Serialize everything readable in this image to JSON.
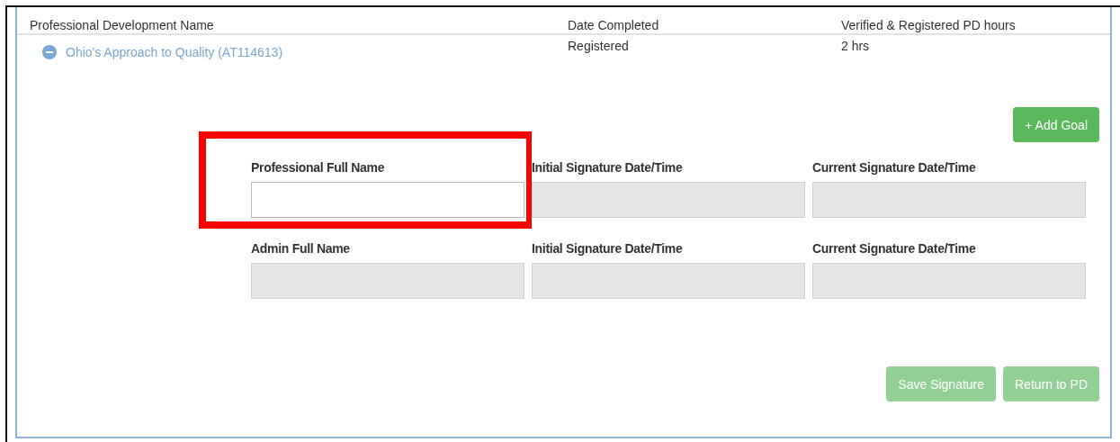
{
  "table": {
    "columns": [
      "Professional Development Name",
      "Date Completed",
      "Verified & Registered PD hours"
    ],
    "rows": [
      {
        "name": "Ohio's Approach to Quality (AT114613)",
        "expanded": true,
        "date_completed": "Registered",
        "hours": "2 hrs"
      }
    ]
  },
  "add_goal_button": {
    "label": "+ Add Goal",
    "disabled": false
  },
  "signature_rows": [
    {
      "fields": [
        {
          "label": "Professional Full Name",
          "disabled": false,
          "highlighted": true
        },
        {
          "label": "Initial Signature Date/Time",
          "disabled": true,
          "highlighted": false
        },
        {
          "label": "Current Signature Date/Time",
          "disabled": true,
          "highlighted": false
        }
      ]
    },
    {
      "fields": [
        {
          "label": "Admin Full Name",
          "disabled": true,
          "highlighted": false
        },
        {
          "label": "Initial Signature Date/Time",
          "disabled": true,
          "highlighted": false
        },
        {
          "label": "Current Signature Date/Time",
          "disabled": true,
          "highlighted": false
        }
      ]
    }
  ],
  "buttons": [
    {
      "label": "Save Signature",
      "disabled": true
    },
    {
      "label": "Return to PD",
      "disabled": true
    }
  ]
}
